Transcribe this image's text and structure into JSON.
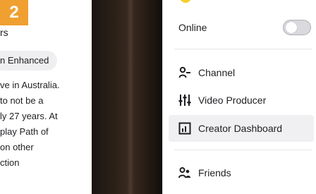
{
  "step_badge": "2",
  "left_panel": {
    "partial_heading": "rs",
    "tag_label": "n Enhanced",
    "description_lines": [
      "ve in Australia.",
      " to not be a",
      "ly 27 years. At",
      "play Path of",
      " on other",
      "ction"
    ]
  },
  "menu": {
    "online_label": "Online",
    "online_toggle": "off",
    "items": [
      {
        "label": "Channel",
        "icon": "channel-icon"
      },
      {
        "label": "Video Producer",
        "icon": "video-producer-icon"
      },
      {
        "label": "Creator Dashboard",
        "icon": "creator-dashboard-icon"
      },
      {
        "label": "Friends",
        "icon": "friends-icon"
      }
    ]
  },
  "colors": {
    "badge": "#f0a030",
    "avatar": "#f5d02c",
    "active_row": "#f0f0f3"
  }
}
